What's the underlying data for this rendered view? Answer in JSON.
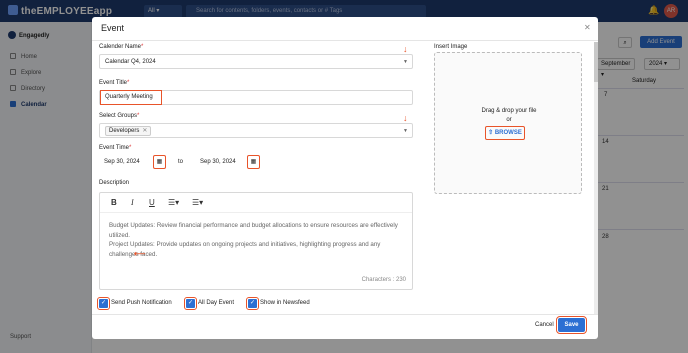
{
  "app": {
    "brand": "theEMPLOYEEapp",
    "org": "Engagedly",
    "avatar_initials": "AR"
  },
  "search": {
    "scope": "All",
    "placeholder": "Search for contents, folders, events, contacts or # Tags"
  },
  "sidebar": {
    "items": [
      {
        "label": "Home",
        "icon": "home-icon"
      },
      {
        "label": "Explore",
        "icon": "explore-icon"
      },
      {
        "label": "Directory",
        "icon": "directory-icon"
      },
      {
        "label": "Calendar",
        "icon": "calendar-icon",
        "active": true
      }
    ],
    "support": "Support"
  },
  "calendar_bg": {
    "add_event": "Add Event",
    "month": "September",
    "year": "2024",
    "weekday": "Saturday",
    "dates": [
      "7",
      "14",
      "21",
      "28"
    ]
  },
  "modal": {
    "title": "Event",
    "calendar_name": {
      "label": "Calender Name",
      "value": "Calendar Q4, 2024"
    },
    "event_title": {
      "label": "Event Title",
      "value": "Quarterly Meeting"
    },
    "groups": {
      "label": "Select Groups",
      "chips": [
        "Developers"
      ]
    },
    "event_time": {
      "label": "Event Time",
      "start": "Sep 30, 2024",
      "separator": "to",
      "end": "Sep 30, 2024"
    },
    "description": {
      "label": "Description",
      "paragraphs": [
        "Budget Updates: Review financial performance and budget allocations to ensure resources are effectively utilized.",
        "Project Updates: Provide updates on ongoing projects and initiatives, highlighting progress and any challenges faced."
      ],
      "characters": "Characters : 230"
    },
    "insert_image": {
      "label": "Insert Image",
      "drag_text": "Drag & drop your file",
      "or": "or",
      "browse": "BROWSE"
    },
    "checkboxes": [
      {
        "label": "Send Push Notification",
        "checked": true
      },
      {
        "label": "All Day Event",
        "checked": true
      },
      {
        "label": "Show in Newsfeed",
        "checked": true
      }
    ],
    "cancel": "Cancel",
    "save": "Save"
  }
}
